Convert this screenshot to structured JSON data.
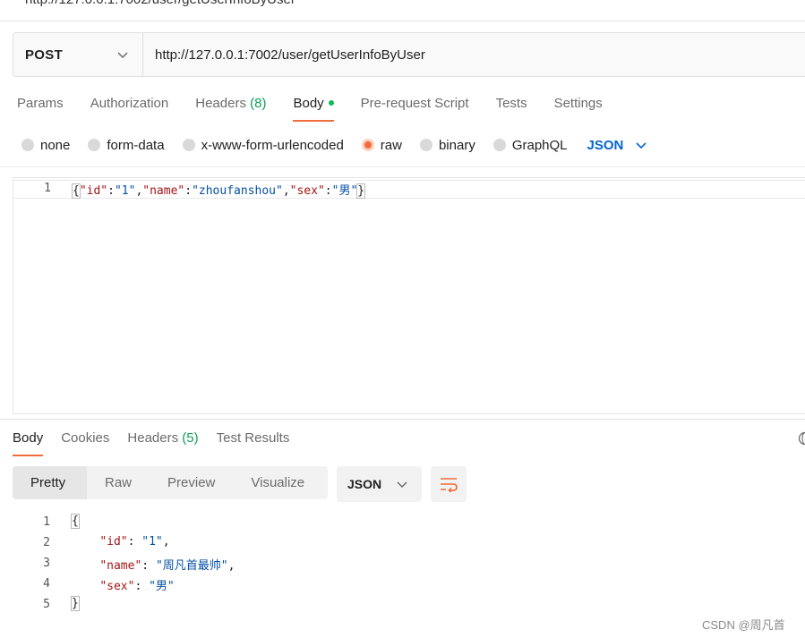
{
  "top": {
    "url_partial": "http://127.0.0.1:7002/user/getUserInfoByUser"
  },
  "request": {
    "method": "POST",
    "url": "http://127.0.0.1:7002/user/getUserInfoByUser"
  },
  "request_tabs": {
    "params": "Params",
    "authorization": "Authorization",
    "headers": "Headers",
    "headers_count": "(8)",
    "body": "Body",
    "prerequest": "Pre-request Script",
    "tests": "Tests",
    "settings": "Settings"
  },
  "body_types": {
    "none": "none",
    "form_data": "form-data",
    "urlencoded": "x-www-form-urlencoded",
    "raw": "raw",
    "binary": "binary",
    "graphql": "GraphQL",
    "selected": "raw",
    "language": "JSON"
  },
  "request_editor": {
    "line_number": "1",
    "brace_open": "{",
    "k_id": "\"id\"",
    "colon": ":",
    "v_id": "\"1\"",
    "comma": ",",
    "k_name": "\"name\"",
    "v_name": "\"zhoufanshou\"",
    "k_sex": "\"sex\"",
    "v_sex": "\"男\"",
    "brace_close": "}"
  },
  "response_tabs": {
    "body": "Body",
    "cookies": "Cookies",
    "headers": "Headers",
    "headers_count": "(5)",
    "test_results": "Test Results"
  },
  "response_view": {
    "pretty": "Pretty",
    "raw": "Raw",
    "preview": "Preview",
    "visualize": "Visualize",
    "format": "JSON"
  },
  "response_editor": {
    "lines": [
      {
        "n": "1",
        "brace": "{"
      },
      {
        "n": "2",
        "key": "\"id\"",
        "sep": ": ",
        "val": "\"1\"",
        "end": ","
      },
      {
        "n": "3",
        "key": "\"name\"",
        "sep": ": ",
        "val": "\"周凡首最帅\"",
        "end": ","
      },
      {
        "n": "4",
        "key": "\"sex\"",
        "sep": ": ",
        "val": "\"男\"",
        "end": ""
      },
      {
        "n": "5",
        "brace": "}"
      }
    ]
  },
  "watermark": "CSDN @周凡首",
  "colors": {
    "accent": "#f26b3a",
    "link_blue": "#0265d2",
    "count_green": "#0f9d58",
    "dot_green": "#0cbb52"
  }
}
